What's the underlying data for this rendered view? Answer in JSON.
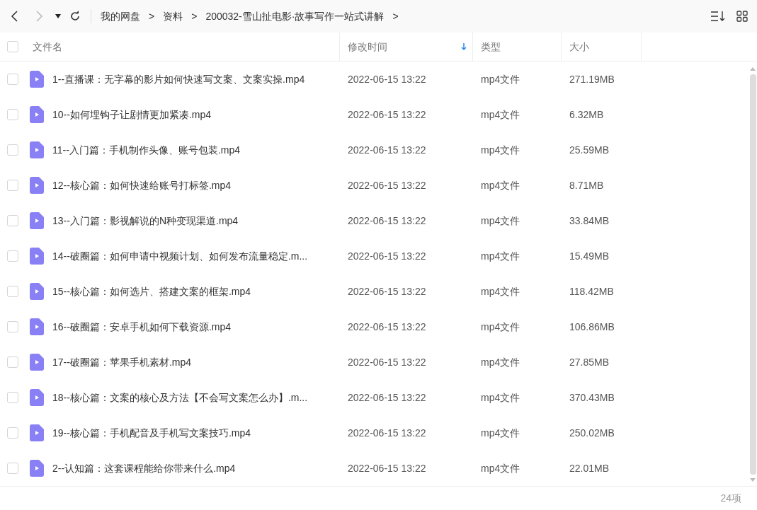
{
  "toolbar": {
    "breadcrumbs": [
      "我的网盘",
      "资料",
      "200032-雪山扯电影·故事写作一站式讲解"
    ],
    "separator": ">"
  },
  "table": {
    "columns": [
      {
        "label": "文件名",
        "sorted": false
      },
      {
        "label": "修改时间",
        "sorted": true
      },
      {
        "label": "类型",
        "sorted": false
      },
      {
        "label": "大小",
        "sorted": false
      }
    ],
    "select_all": {
      "checked": false
    },
    "rows": [
      {
        "name": "1--直播课：无字幕的影片如何快速写文案、文案实操.mp4",
        "modified": "2022-06-15 13:22",
        "type": "mp4文件",
        "size": "271.19MB",
        "checked": false
      },
      {
        "name": "10--如何埋钩子让剧情更加紧凑.mp4",
        "modified": "2022-06-15 13:22",
        "type": "mp4文件",
        "size": "6.32MB",
        "checked": false
      },
      {
        "name": "11--入门篇：手机制作头像、账号包装.mp4",
        "modified": "2022-06-15 13:22",
        "type": "mp4文件",
        "size": "25.59MB",
        "checked": false
      },
      {
        "name": "12--核心篇：如何快速给账号打标签.mp4",
        "modified": "2022-06-15 13:22",
        "type": "mp4文件",
        "size": "8.71MB",
        "checked": false
      },
      {
        "name": "13--入门篇：影视解说的N种变现渠道.mp4",
        "modified": "2022-06-15 13:22",
        "type": "mp4文件",
        "size": "33.84MB",
        "checked": false
      },
      {
        "name": "14--破圈篇：如何申请中视频计划、如何发布流量稳定.m...",
        "modified": "2022-06-15 13:22",
        "type": "mp4文件",
        "size": "15.49MB",
        "checked": false
      },
      {
        "name": "15--核心篇：如何选片、搭建文案的框架.mp4",
        "modified": "2022-06-15 13:22",
        "type": "mp4文件",
        "size": "118.42MB",
        "checked": false
      },
      {
        "name": "16--破圈篇：安卓手机如何下载资源.mp4",
        "modified": "2022-06-15 13:22",
        "type": "mp4文件",
        "size": "106.86MB",
        "checked": false
      },
      {
        "name": "17--破圈篇：苹果手机素材.mp4",
        "modified": "2022-06-15 13:22",
        "type": "mp4文件",
        "size": "27.85MB",
        "checked": false
      },
      {
        "name": "18--核心篇：文案的核心及方法【不会写文案怎么办】.m...",
        "modified": "2022-06-15 13:22",
        "type": "mp4文件",
        "size": "370.43MB",
        "checked": false
      },
      {
        "name": "19--核心篇：手机配音及手机写文案技巧.mp4",
        "modified": "2022-06-15 13:22",
        "type": "mp4文件",
        "size": "250.02MB",
        "checked": false
      },
      {
        "name": "2--认知篇：这套课程能给你带来什么.mp4",
        "modified": "2022-06-15 13:22",
        "type": "mp4文件",
        "size": "22.01MB",
        "checked": false
      }
    ]
  },
  "status_bar": {
    "count": "24项"
  }
}
